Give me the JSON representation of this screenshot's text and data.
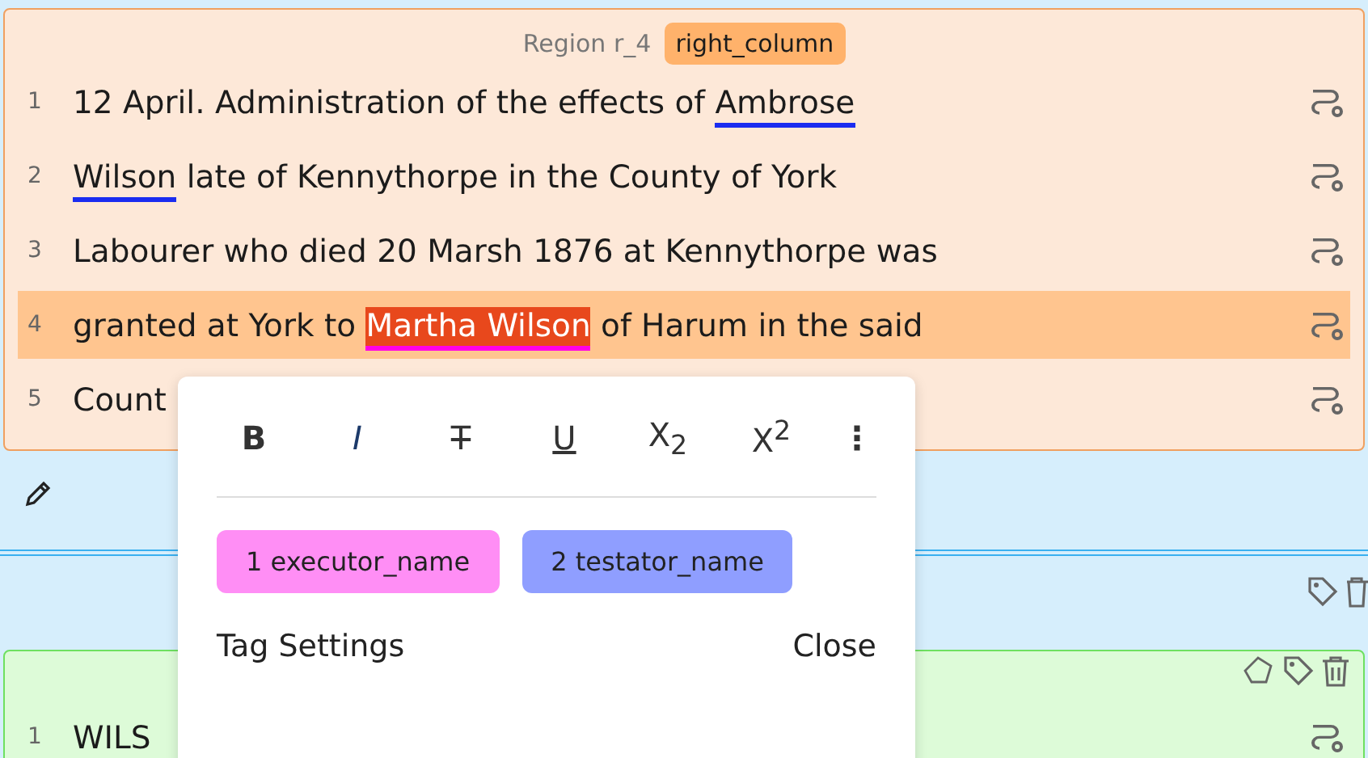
{
  "region": {
    "label": "Region r_4",
    "type": "right_column",
    "lines": [
      {
        "number": "1",
        "selected": false,
        "segments": [
          {
            "text": "12 April. Administration of the effects of "
          },
          {
            "text": "Ambrose",
            "color": "#1a2cf0"
          }
        ]
      },
      {
        "number": "2",
        "selected": false,
        "segments": [
          {
            "text": "Wilson",
            "color": "#1a2cf0"
          },
          {
            "text": " late of Kennythorpe in the County of York"
          }
        ]
      },
      {
        "number": "3",
        "selected": false,
        "segments": [
          {
            "text": "Labourer who died 20 Marsh 1876 at Kennythorpe was"
          }
        ]
      },
      {
        "number": "4",
        "selected": true,
        "segments": [
          {
            "text": "granted at York to "
          },
          {
            "text": "Martha Wilson",
            "color": "#ff00e6",
            "selected": true
          },
          {
            "text": " of Harum in the said"
          }
        ]
      },
      {
        "number": "5",
        "selected": false,
        "segments": [
          {
            "text": "Count"
          }
        ]
      }
    ]
  },
  "next_region": {
    "lines": [
      {
        "number": "1",
        "text": "WILS"
      }
    ]
  },
  "popup": {
    "toolbar": [
      {
        "kind": "bold",
        "label": "B"
      },
      {
        "kind": "italic",
        "label": "I"
      },
      {
        "kind": "strike",
        "label": "T"
      },
      {
        "kind": "underline",
        "label": "U"
      },
      {
        "kind": "sub",
        "label": "X$_{2}$"
      },
      {
        "kind": "sup",
        "label": "X$^{2}$"
      },
      {
        "kind": "more",
        "label": "⋮"
      }
    ],
    "tags": [
      {
        "label": "1 executor_name",
        "color": "#ff8ef5"
      },
      {
        "label": "2 testator_name",
        "color": "#8f9eff"
      }
    ],
    "settings": "Tag Settings",
    "close": "Close"
  }
}
